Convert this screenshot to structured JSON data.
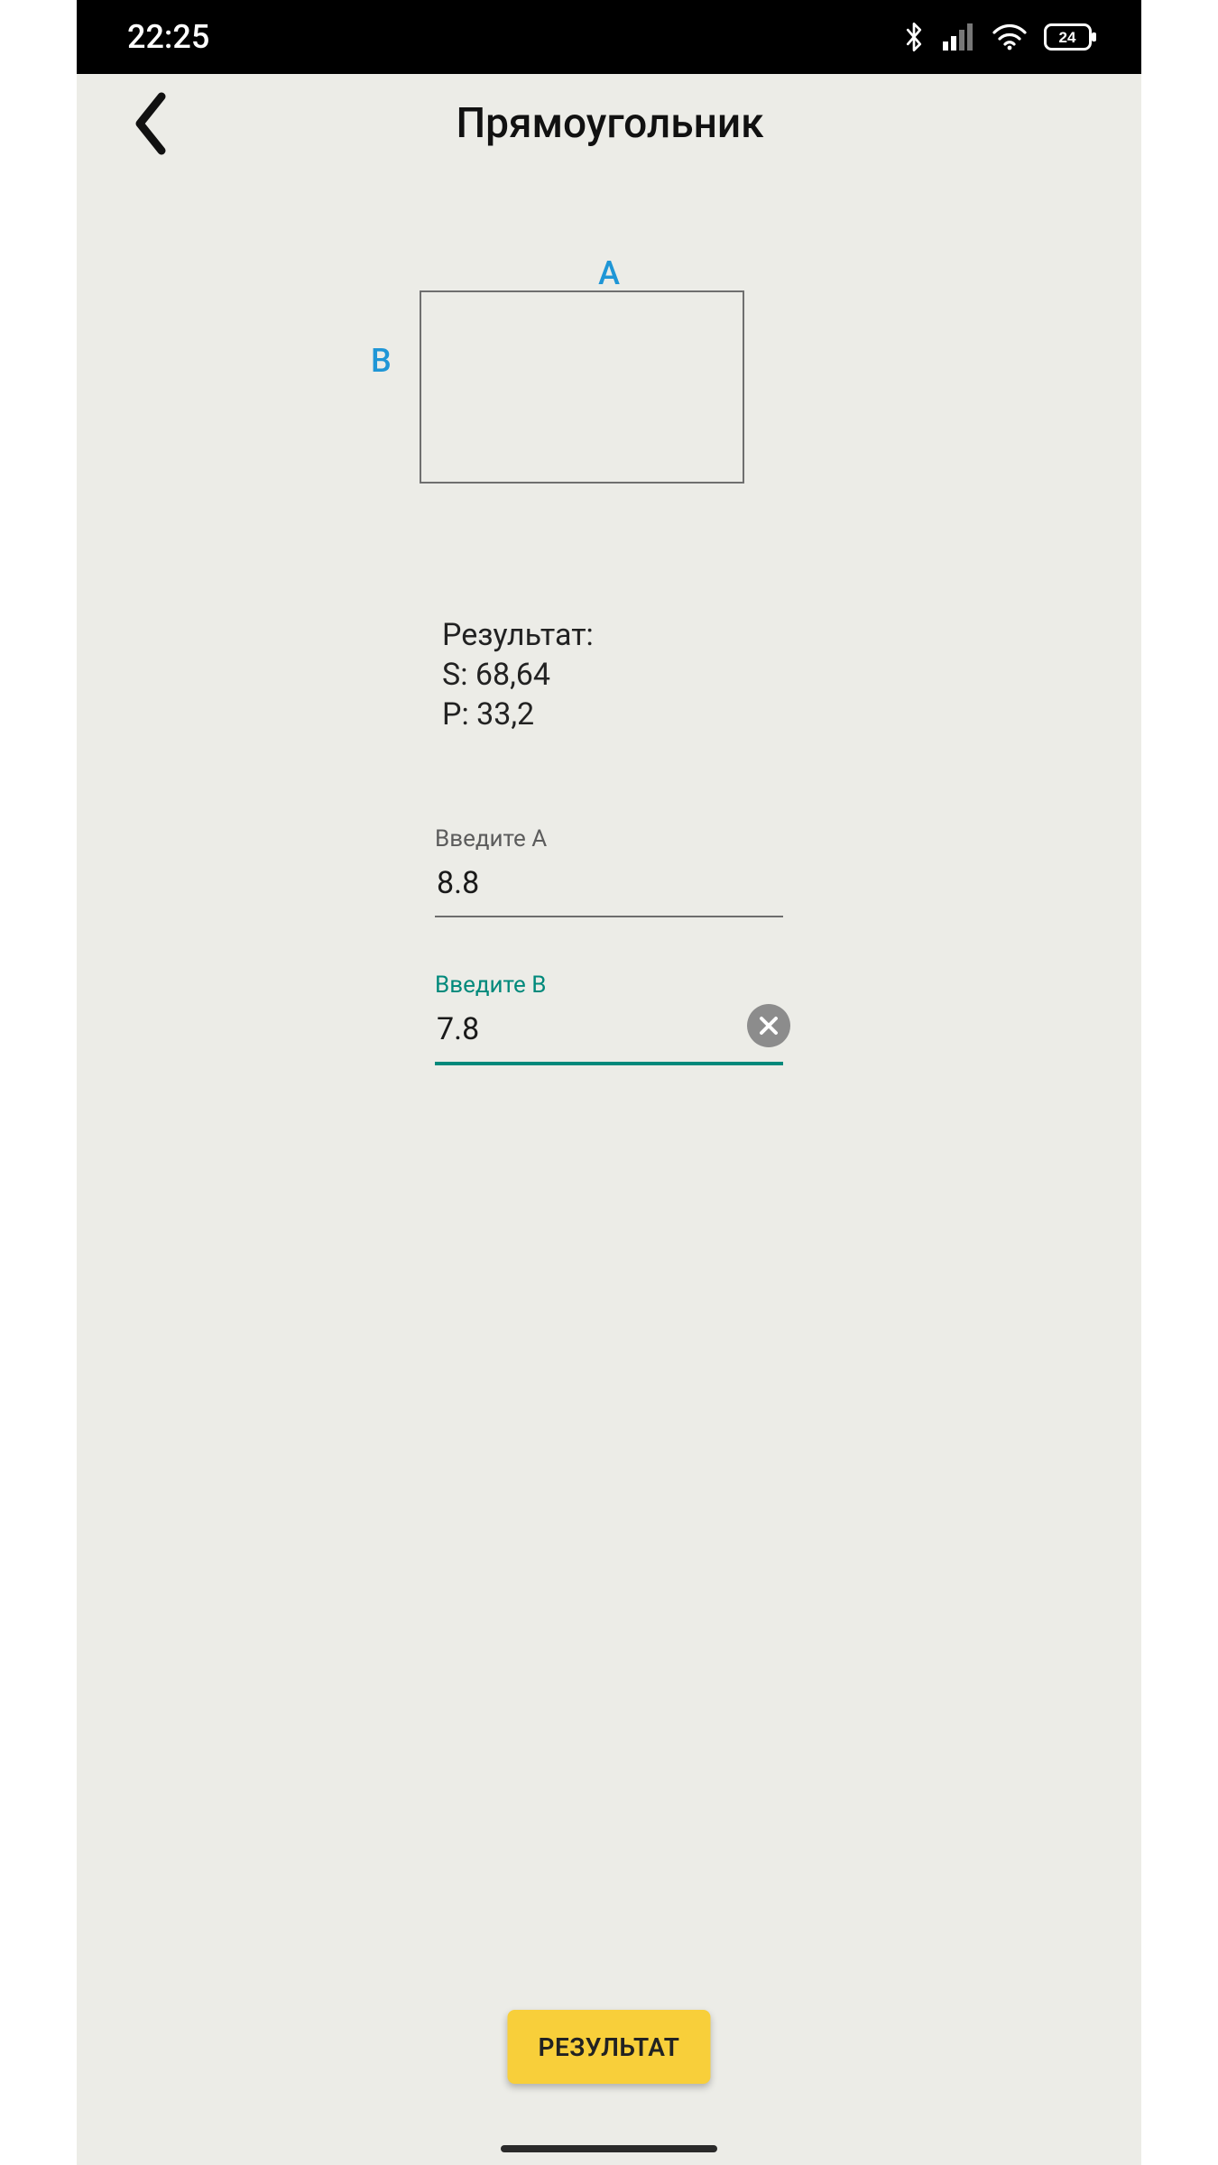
{
  "status": {
    "time": "22:25",
    "battery": "24"
  },
  "header": {
    "title": "Прямоугольник"
  },
  "diagram": {
    "labelA": "A",
    "labelB": "B"
  },
  "result": {
    "title": "Результат:",
    "s_label": "S:",
    "s_value": "68,64",
    "p_label": "P:",
    "p_value": "33,2"
  },
  "fields": {
    "a": {
      "label": "Введите A",
      "value": "8.8"
    },
    "b": {
      "label": "Введите B",
      "value": "7.8"
    }
  },
  "button": {
    "label": "РЕЗУЛЬТАТ"
  }
}
